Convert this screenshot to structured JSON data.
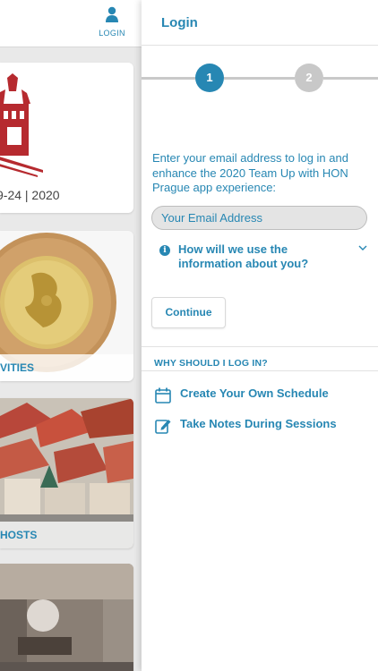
{
  "background": {
    "login_nav_label": "LOGIN",
    "cards": {
      "logo_date": "9-24 | 2020",
      "coin_caption": "VITIES",
      "city_caption": "HOSTS"
    }
  },
  "panel": {
    "title": "Login",
    "steps": [
      "1",
      "2"
    ],
    "intro": "Enter your email address to log in and enhance the 2020 Team Up with HON Prague app experience:",
    "email_placeholder": "Your Email Address",
    "info_question": "How will we use the information about you?",
    "continue_label": "Continue",
    "why_label": "WHY SHOULD I LOG IN?",
    "benefits": [
      {
        "label": "Create Your Own Schedule",
        "icon": "calendar-icon"
      },
      {
        "label": "Take Notes During Sessions",
        "icon": "edit-note-icon"
      }
    ]
  },
  "colors": {
    "accent": "#2787b3",
    "step_inactive": "#c8c8c8",
    "divider": "#e2e2e2"
  }
}
